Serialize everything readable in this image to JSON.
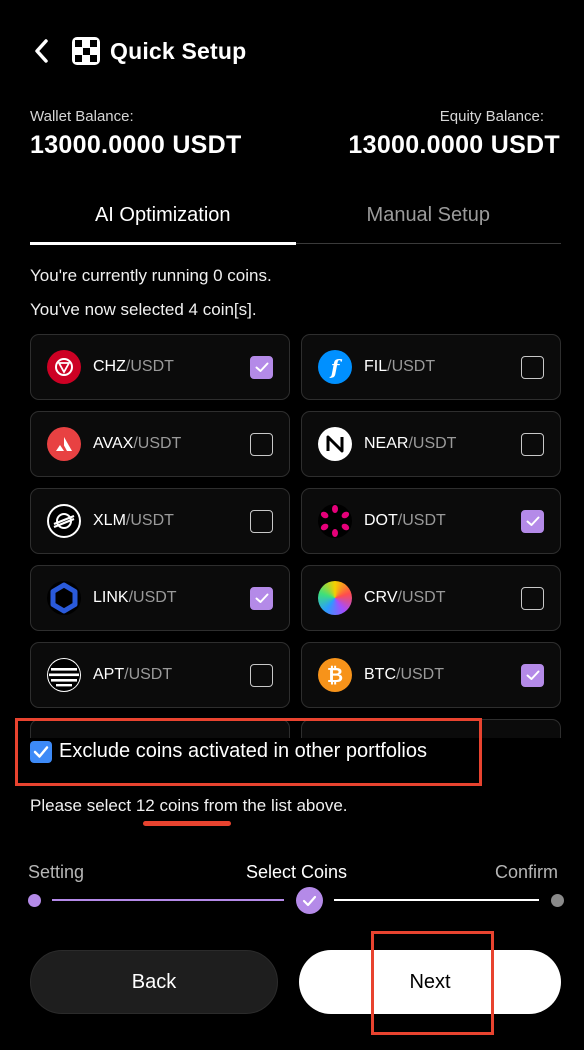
{
  "header": {
    "title": "Quick Setup",
    "back_icon": "chevron-left-icon",
    "logo_icon": "okx-logo-icon"
  },
  "balances": {
    "wallet_label": "Wallet Balance:",
    "wallet_value": "13000.0000 USDT",
    "equity_label": "Equity Balance:",
    "equity_value": "13000.0000 USDT"
  },
  "tabs": [
    {
      "label": "AI Optimization",
      "active": true
    },
    {
      "label": "Manual Setup",
      "active": false
    }
  ],
  "info": {
    "running": "You're currently running 0 coins.",
    "selected": "You've now selected 4 coin[s]."
  },
  "coins": [
    {
      "base": "CHZ",
      "quote": "/USDT",
      "checked": true,
      "icon": "chz-icon",
      "color": "#cd0124"
    },
    {
      "base": "FIL",
      "quote": "/USDT",
      "checked": false,
      "icon": "fil-icon",
      "color": "#0090ff"
    },
    {
      "base": "AVAX",
      "quote": "/USDT",
      "checked": false,
      "icon": "avax-icon",
      "color": "#e84142"
    },
    {
      "base": "NEAR",
      "quote": "/USDT",
      "checked": false,
      "icon": "near-icon",
      "color": "#ffffff"
    },
    {
      "base": "XLM",
      "quote": "/USDT",
      "checked": false,
      "icon": "xlm-icon",
      "color": "#000000"
    },
    {
      "base": "DOT",
      "quote": "/USDT",
      "checked": true,
      "icon": "dot-icon",
      "color": "#e6007a"
    },
    {
      "base": "LINK",
      "quote": "/USDT",
      "checked": true,
      "icon": "link-icon",
      "color": "#2a5ada"
    },
    {
      "base": "CRV",
      "quote": "/USDT",
      "checked": false,
      "icon": "crv-icon",
      "color": "#f5d000"
    },
    {
      "base": "APT",
      "quote": "/USDT",
      "checked": false,
      "icon": "apt-icon",
      "color": "#000000"
    },
    {
      "base": "BTC",
      "quote": "/USDT",
      "checked": true,
      "icon": "btc-icon",
      "color": "#f7931a"
    }
  ],
  "exclude": {
    "label": "Exclude coins activated in other portfolios",
    "checked": true
  },
  "hint": {
    "prefix": "Please select ",
    "count": "12 coins",
    "suffix": " from the list above."
  },
  "steps": [
    {
      "label": "Setting",
      "state": "done"
    },
    {
      "label": "Select Coins",
      "state": "current"
    },
    {
      "label": "Confirm",
      "state": "pending"
    }
  ],
  "colors": {
    "accent": "#b48ae8",
    "highlight": "#e8432f",
    "checkbox_blue": "#3d8af7"
  },
  "buttons": {
    "back": "Back",
    "next": "Next"
  }
}
